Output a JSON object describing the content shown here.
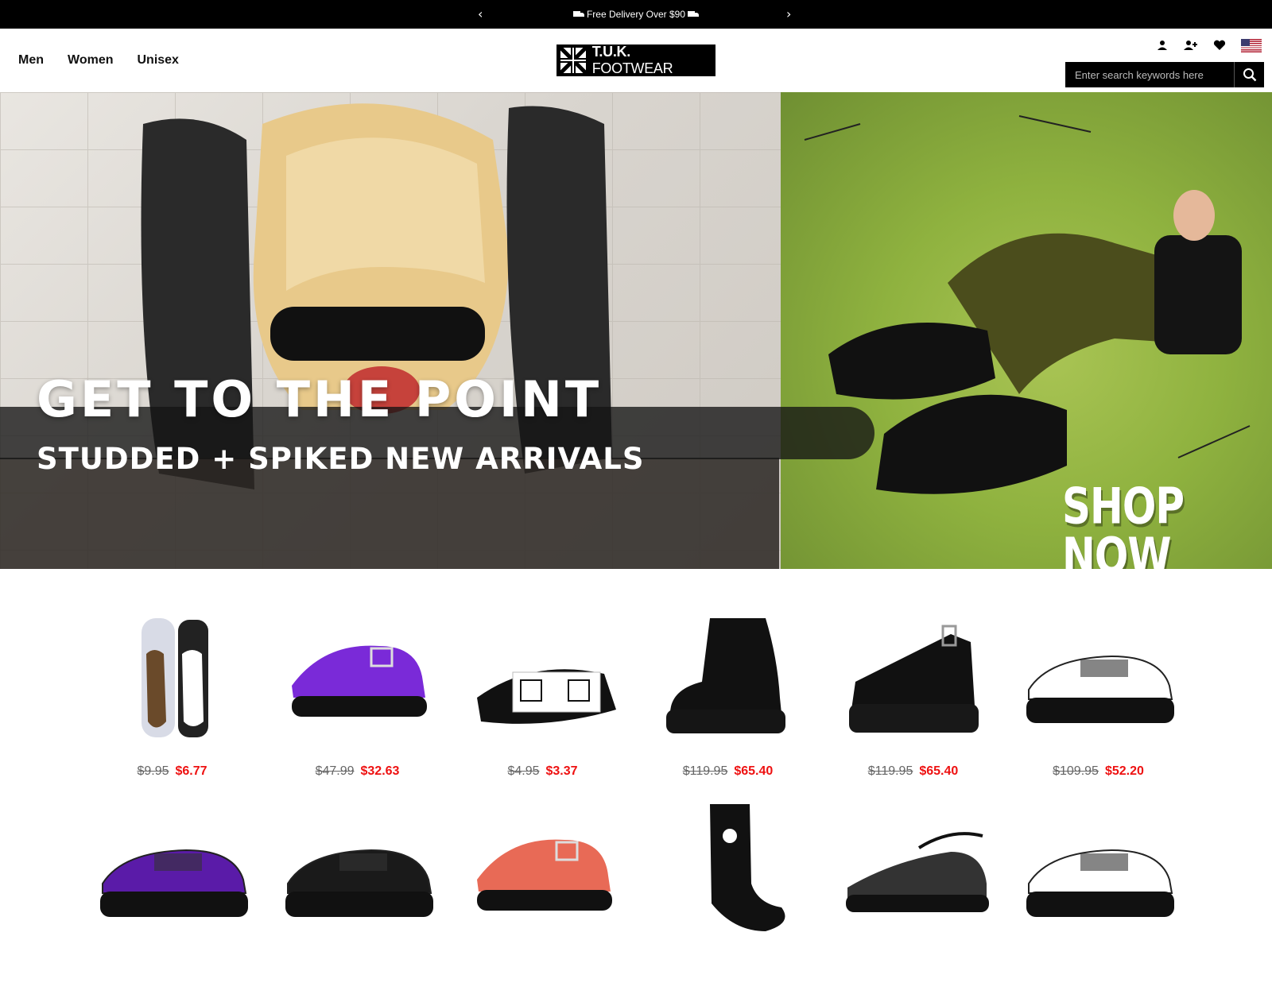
{
  "announcement": {
    "prev_arrow": "‹",
    "next_arrow": "›",
    "message": "Free Delivery Over $90"
  },
  "nav": {
    "items": [
      {
        "label": "Men"
      },
      {
        "label": "Women"
      },
      {
        "label": "Unisex"
      }
    ]
  },
  "logo": {
    "brand": "T.U.K.",
    "suffix": "FOOTWEAR"
  },
  "search": {
    "placeholder": "Enter search keywords here"
  },
  "header_icons": [
    "account-icon",
    "add-user-icon",
    "heart-icon",
    "us-flag-icon",
    "search-icon"
  ],
  "hero": {
    "headline": "GET TO THE POINT",
    "subhead": "STUDDED + SPIKED NEW ARRIVALS",
    "cta": "SHOP NOW"
  },
  "products": [
    {
      "kind": "insole",
      "old_price": "$9.95",
      "new_price": "$6.77",
      "color": "#6a4a2a"
    },
    {
      "kind": "maryjane",
      "old_price": "$47.99",
      "new_price": "$32.63",
      "color": "#7a2ad8"
    },
    {
      "kind": "laces",
      "old_price": "$4.95",
      "new_price": "$3.37",
      "color": "#111111"
    },
    {
      "kind": "boot",
      "old_price": "$119.95",
      "new_price": "$65.40",
      "color": "#111111"
    },
    {
      "kind": "sandal",
      "old_price": "$119.95",
      "new_price": "$65.40",
      "color": "#111111"
    },
    {
      "kind": "creeper",
      "old_price": "$109.95",
      "new_price": "$52.20",
      "color": "#ffffff"
    },
    {
      "kind": "creeper",
      "color": "#5a1ba8"
    },
    {
      "kind": "creeper",
      "color": "#1a1a1a"
    },
    {
      "kind": "maryjane",
      "color": "#e86a56"
    },
    {
      "kind": "sock",
      "color": "#111111"
    },
    {
      "kind": "flat",
      "color": "#333333"
    },
    {
      "kind": "creeper",
      "color": "#ffffff"
    }
  ]
}
